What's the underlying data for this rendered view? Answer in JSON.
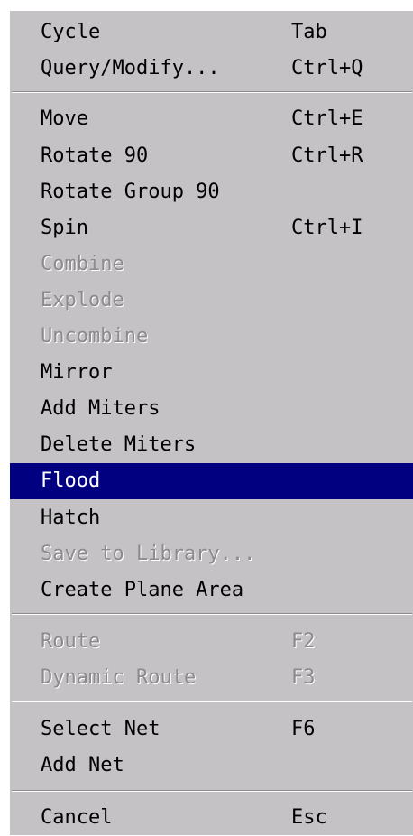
{
  "menu": {
    "items": [
      {
        "label": "Cycle",
        "shortcut": "Tab"
      },
      {
        "label": "Query/Modify...",
        "shortcut": "Ctrl+Q"
      },
      {
        "label": "Move",
        "shortcut": "Ctrl+E"
      },
      {
        "label": "Rotate 90",
        "shortcut": "Ctrl+R"
      },
      {
        "label": "Rotate Group 90",
        "shortcut": ""
      },
      {
        "label": "Spin",
        "shortcut": "Ctrl+I"
      },
      {
        "label": "Combine",
        "shortcut": "",
        "disabled": true
      },
      {
        "label": "Explode",
        "shortcut": "",
        "disabled": true
      },
      {
        "label": "Uncombine",
        "shortcut": "",
        "disabled": true
      },
      {
        "label": "Mirror",
        "shortcut": ""
      },
      {
        "label": "Add Miters",
        "shortcut": ""
      },
      {
        "label": "Delete Miters",
        "shortcut": ""
      },
      {
        "label": "Flood",
        "shortcut": "",
        "selected": true
      },
      {
        "label": "Hatch",
        "shortcut": ""
      },
      {
        "label": "Save to Library...",
        "shortcut": "",
        "disabled": true
      },
      {
        "label": "Create Plane Area",
        "shortcut": ""
      },
      {
        "label": "Route",
        "shortcut": "F2",
        "disabled": true
      },
      {
        "label": "Dynamic Route",
        "shortcut": "F3",
        "disabled": true
      },
      {
        "label": "Select Net",
        "shortcut": "F6"
      },
      {
        "label": "Add Net",
        "shortcut": ""
      },
      {
        "label": "Cancel",
        "shortcut": "Esc"
      }
    ]
  },
  "colors": {
    "menu_background": "#c4c2c4",
    "selection_background": "#000080",
    "selection_text": "#ffffff",
    "disabled_text": "#8c8a8c"
  }
}
